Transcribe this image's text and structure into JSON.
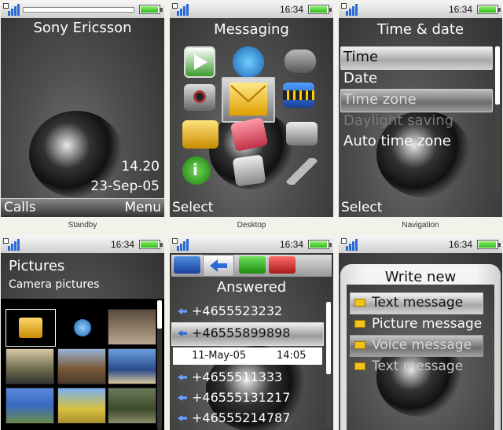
{
  "status": {
    "time": "16:34"
  },
  "standby": {
    "operator": "Sony Ericsson",
    "time": "14.20",
    "date": "23-Sep-05",
    "left_soft": "Calls",
    "right_soft": "Menu",
    "caption": "Standby"
  },
  "desktop": {
    "title": "Messaging",
    "select": "Select",
    "caption": "Desktop",
    "icons": [
      "internet-icon",
      "web-globe-icon",
      "games-icon",
      "camera-icon",
      "messaging-icon",
      "media-icon",
      "file-manager-icon",
      "contacts-icon",
      "radio-icon",
      "phone-info-icon",
      "organizer-icon",
      "settings-icon"
    ]
  },
  "navigation": {
    "title": "Time & date",
    "items": [
      "Time",
      "Date",
      "Time zone",
      "Daylight saving",
      "Auto time zone"
    ],
    "select": "Select",
    "caption": "Navigation"
  },
  "pictures": {
    "title": "Pictures",
    "subtitle": "Camera pictures"
  },
  "calls": {
    "title": "Answered",
    "entries": [
      "+4655523232",
      "+46555899898",
      "+4655511333",
      "+46555131217",
      "+46555214787"
    ],
    "detail_date": "11-May-05",
    "detail_time": "14:05"
  },
  "write": {
    "title": "Write new",
    "items": [
      "Text message",
      "Picture message",
      "Voice message",
      "Text message"
    ]
  },
  "colors": {
    "accent": "#2a6bd6",
    "battery": "#2fb81a"
  }
}
